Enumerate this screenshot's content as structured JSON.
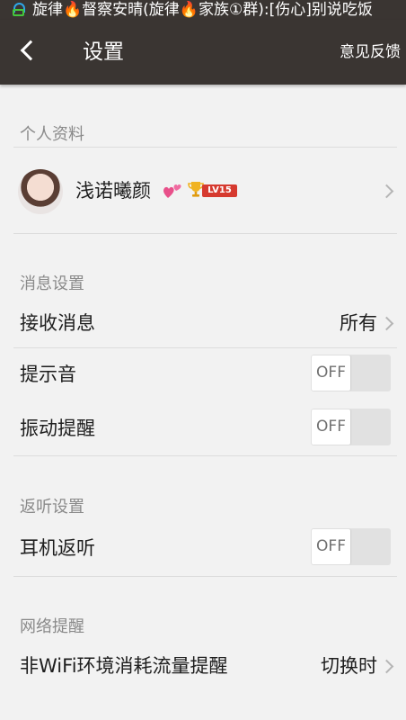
{
  "status_bar": {
    "notification_text": "旋律🔥督察安晴(旋律🔥家族①群):[伤心]别说吃饭"
  },
  "header": {
    "back_icon": "back-arrow-icon",
    "title": "设置",
    "feedback_label": "意见反馈"
  },
  "profile_section": {
    "label": "个人资料",
    "nickname": "浅诺曦颜",
    "level_badge": "LV15",
    "icons": [
      "avatar-image",
      "hearts-icon",
      "trophy-icon",
      "chevron-right-icon"
    ]
  },
  "message_section": {
    "label": "消息设置",
    "receive_label": "接收消息",
    "receive_value": "所有",
    "sound_label": "提示音",
    "sound_toggle": "OFF",
    "vibrate_label": "振动提醒",
    "vibrate_toggle": "OFF"
  },
  "monitor_section": {
    "label": "返听设置",
    "earphone_label": "耳机返听",
    "earphone_toggle": "OFF"
  },
  "network_section": {
    "label": "网络提醒",
    "wifi_label": "非WiFi环境消耗流量提醒",
    "wifi_value": "切换时"
  },
  "colors": {
    "header_bg": "#3a3532",
    "page_bg": "#f2f2f2",
    "level_badge_bg": "#d63a2f"
  }
}
